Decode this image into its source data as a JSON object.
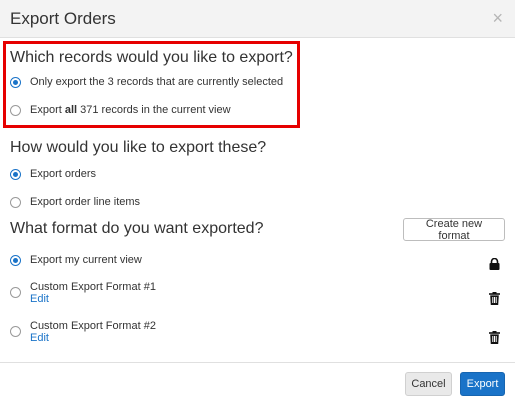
{
  "dialog": {
    "title": "Export Orders",
    "close_glyph": "×"
  },
  "records_section": {
    "heading": "Which records would you like to export?",
    "options": [
      {
        "label": "Only export the 3 records that are currently selected",
        "selected": true
      },
      {
        "label_prefix": "Export ",
        "label_bold": "all",
        "label_suffix": " 371 records in the current view",
        "selected": false
      }
    ]
  },
  "export_type_section": {
    "heading": "How would you like to export these?",
    "options": [
      {
        "label": "Export orders",
        "selected": true
      },
      {
        "label": "Export order line items",
        "selected": false
      }
    ]
  },
  "format_section": {
    "heading": "What format do you want exported?",
    "create_button_label": "Create new format",
    "options": [
      {
        "label": "Export my current view",
        "selected": true,
        "icon": "lock-icon"
      },
      {
        "label": "Custom Export Format #1",
        "edit_label": "Edit",
        "selected": false,
        "icon": "trash-icon"
      },
      {
        "label": "Custom Export Format #2",
        "edit_label": "Edit",
        "selected": false,
        "icon": "trash-icon"
      }
    ]
  },
  "footer": {
    "cancel_label": "Cancel",
    "export_label": "Export"
  },
  "colors": {
    "accent": "#1a73c8",
    "highlight_border": "#e60000",
    "header_bg": "#f3f3f3"
  }
}
